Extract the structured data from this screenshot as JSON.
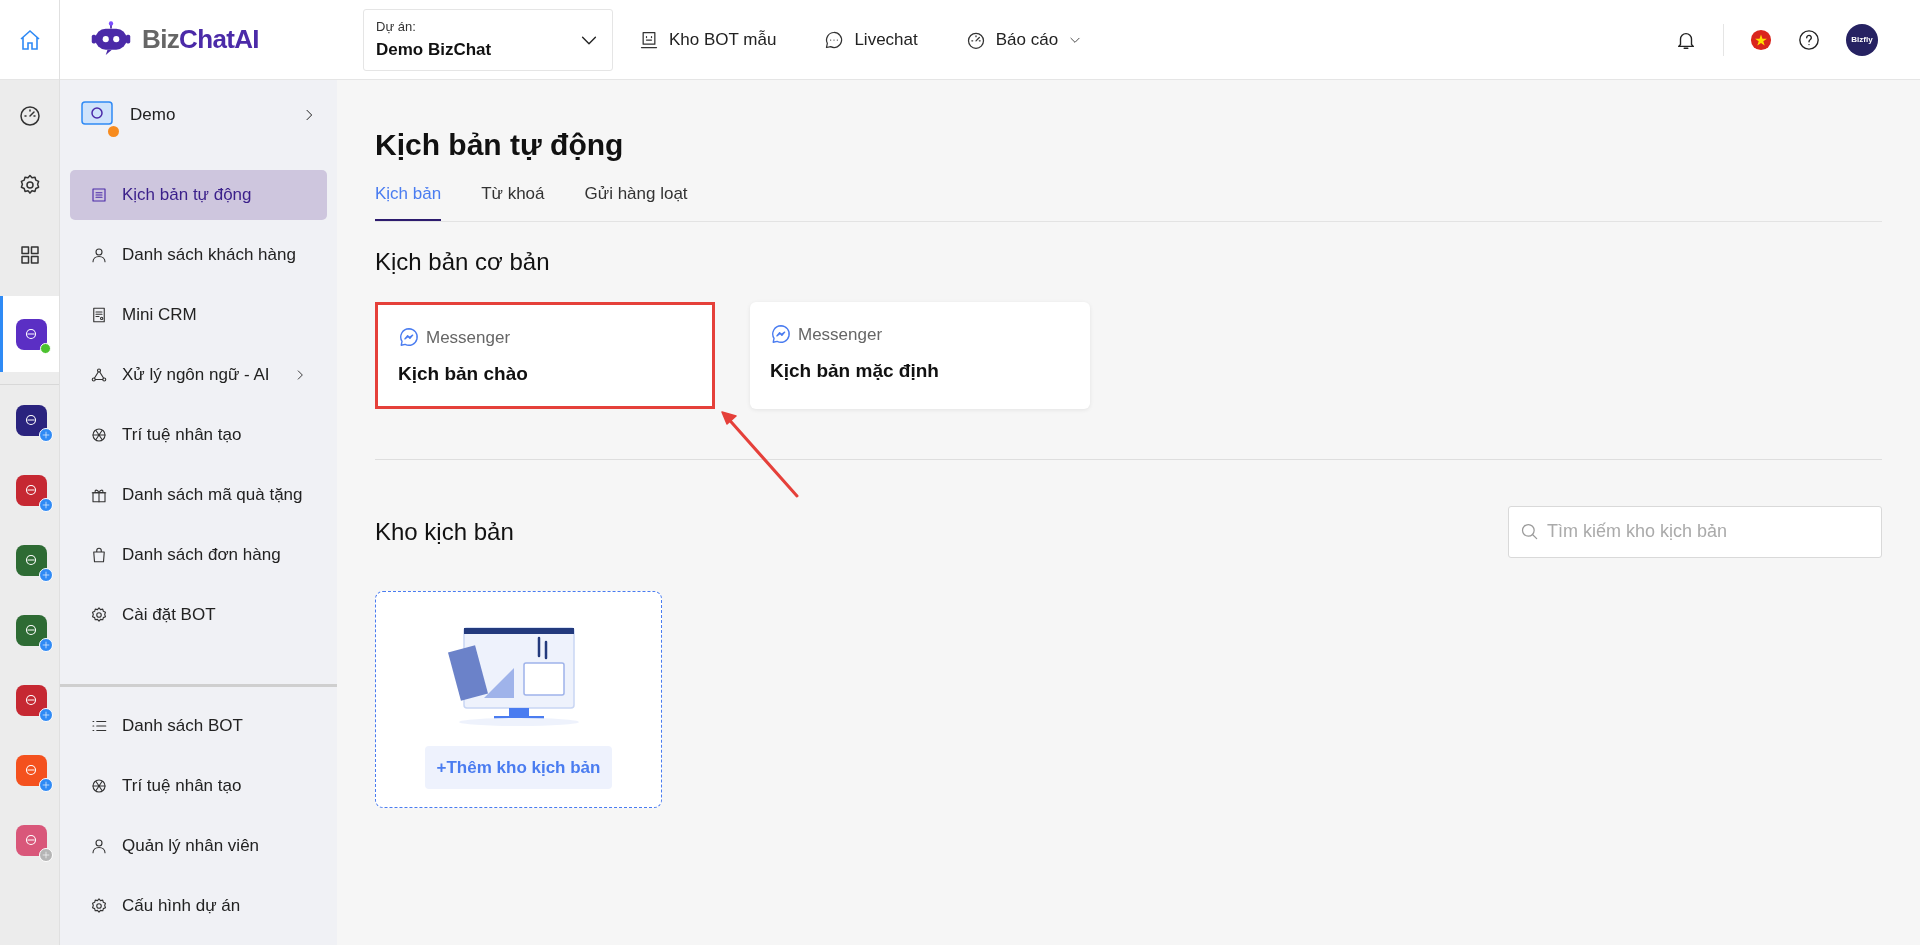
{
  "topbar": {
    "logo": {
      "prefix": "Biz",
      "name": "ChatAI"
    },
    "project": {
      "label": "Dự án:",
      "value": "Demo BizChat"
    },
    "nav": [
      {
        "kind": "template",
        "label": "Kho BOT mẫu",
        "dropdown": false
      },
      {
        "kind": "chat",
        "label": "Livechat",
        "dropdown": false
      },
      {
        "kind": "report",
        "label": "Báo cáo",
        "dropdown": true
      }
    ],
    "avatar": {
      "text": "Bizfly"
    }
  },
  "rail": {
    "tools": [
      {
        "kind": "dashboard"
      },
      {
        "kind": "settings"
      },
      {
        "kind": "apps"
      }
    ],
    "apps": [
      {
        "color": "#5b2fc4",
        "selected": true,
        "kind": "online"
      },
      {
        "color": "#2a237e",
        "selected": false,
        "kind": "add"
      },
      {
        "color": "#c62832",
        "selected": false,
        "kind": "add"
      },
      {
        "color": "#2e6b34",
        "selected": false,
        "kind": "add"
      },
      {
        "color": "#2e6b34",
        "selected": false,
        "kind": "add"
      },
      {
        "color": "#c62832",
        "selected": false,
        "kind": "add"
      },
      {
        "color": "#f4511e",
        "selected": false,
        "kind": "add"
      },
      {
        "color": "#d9577a",
        "selected": false,
        "kind": "inactive"
      }
    ]
  },
  "sidebar": {
    "project": {
      "name": "Demo",
      "expandable": true
    },
    "items": [
      {
        "kind": "script",
        "label": "Kịch bản tự động",
        "selected": true,
        "expandable": false
      },
      {
        "kind": "person",
        "label": "Danh sách khách hàng",
        "selected": false,
        "expandable": false
      },
      {
        "kind": "crm",
        "label": "Mini CRM",
        "selected": false,
        "expandable": false
      },
      {
        "kind": "nlp",
        "label": "Xử lý ngôn ngữ - AI",
        "selected": false,
        "expandable": true
      },
      {
        "kind": "ai",
        "label": "Trí tuệ nhân tạo",
        "selected": false,
        "expandable": false
      },
      {
        "kind": "gift",
        "label": "Danh sách mã quà tặng",
        "selected": false,
        "expandable": false
      },
      {
        "kind": "bag",
        "label": "Danh sách đơn hàng",
        "selected": false,
        "expandable": false
      },
      {
        "kind": "gear",
        "label": "Cài đặt BOT",
        "selected": false,
        "expandable": false
      }
    ],
    "bottom_items": [
      {
        "kind": "list",
        "label": "Danh sách BOT",
        "selected": false,
        "expandable": false
      },
      {
        "kind": "ai",
        "label": "Trí tuệ nhân tạo",
        "selected": false,
        "expandable": false
      },
      {
        "kind": "person",
        "label": "Quản lý nhân viên",
        "selected": false,
        "expandable": false
      },
      {
        "kind": "gear",
        "label": "Cấu hình dự án",
        "selected": false,
        "expandable": false
      }
    ]
  },
  "main": {
    "title": "Kịch bản tự động",
    "tabs": [
      {
        "label": "Kịch bản",
        "selected": true
      },
      {
        "label": "Từ khoá",
        "selected": false
      },
      {
        "label": "Gửi hàng loạt",
        "selected": false
      }
    ],
    "basic": {
      "title": "Kịch bản cơ bản",
      "cards": [
        {
          "channel": "Messenger",
          "title": "Kịch bản chào",
          "highlighted": true
        },
        {
          "channel": "Messenger",
          "title": "Kịch bản mặc định",
          "highlighted": false
        }
      ]
    },
    "annotation_arrow": true,
    "library": {
      "title": "Kho kịch bản",
      "search": {
        "placeholder": "Tìm kiếm kho kịch bản"
      },
      "add_button": "+Thêm kho kịch bản"
    }
  }
}
